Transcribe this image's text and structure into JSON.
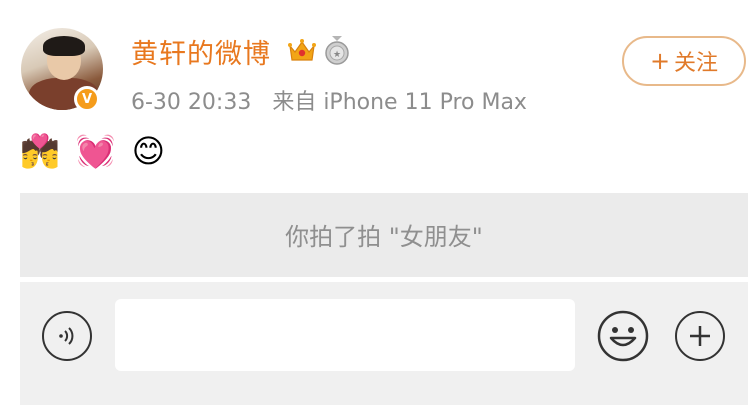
{
  "post": {
    "username": "黄轩的微博",
    "time": "6-30 20:33",
    "source": "来自 iPhone 11 Pro Max",
    "follow_label": "关注",
    "emojis": [
      "💏",
      "💓",
      "😊"
    ]
  },
  "notice": {
    "text": "你拍了拍 \"女朋友\""
  },
  "composer": {
    "input_value": ""
  },
  "colors": {
    "username": "#e8781f",
    "follow_border": "#e8b98a",
    "notice_bg": "#ebebeb",
    "input_area_bg": "#f0f0f0"
  },
  "icons": [
    "avatar",
    "verified-badge-icon",
    "crown-icon",
    "medal-icon",
    "plus-icon",
    "voice-icon",
    "emoji-face-icon",
    "add-icon"
  ]
}
